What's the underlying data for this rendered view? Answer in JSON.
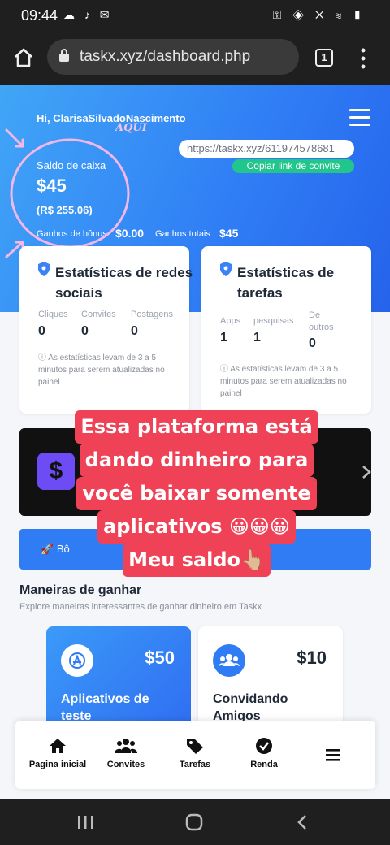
{
  "status_bar": {
    "time": "09:44"
  },
  "browser": {
    "url": "taskx.xyz/dashboard.php",
    "tab_count": "1"
  },
  "hero": {
    "greeting": "Hi, ClarisaSilvadoNascimento",
    "annotation": "AQUI",
    "invite_url": "https://taskx.xyz/611974578681",
    "copy_button": "Copiar link de convite",
    "saldo_label": "Saldo de caixa",
    "saldo_usd": "$45",
    "saldo_brl": "(R$ 255,06)",
    "bonus_label": "Ganhos de bônus",
    "bonus_value": "$0.00",
    "total_label": "Ganhos totais",
    "total_value": "$45"
  },
  "social_stats": {
    "title": "Estatísticas de redes sociais",
    "stats": [
      {
        "label": "Cliques",
        "value": "0"
      },
      {
        "label": "Convites",
        "value": "0"
      },
      {
        "label": "Postagens",
        "value": "0"
      }
    ],
    "note": "As estatísticas levam de 3 a 5 minutos para serem atualizadas no painel"
  },
  "task_stats": {
    "title": "Estatísticas de tarefas",
    "stats": [
      {
        "label": "Apps",
        "value": "1"
      },
      {
        "label": "pesquisas",
        "value": "1"
      },
      {
        "label": "De outros",
        "value": "0"
      }
    ],
    "note": "As estatísticas levam de 3 a 5 minutos para serem atualizadas no painel"
  },
  "banner": {
    "tile_symbol": "$"
  },
  "bonus_button": {
    "label": "Bô"
  },
  "ways": {
    "title": "Maneiras de ganhar",
    "subtitle": "Explore maneiras interessantes de ganhar dinheiro em Taskx",
    "cards": [
      {
        "amount": "$50",
        "name": "Aplicativos de teste",
        "color": "#3b82f6"
      },
      {
        "amount": "$10",
        "name": "Convidando Amigos",
        "color": "#ffffff"
      }
    ]
  },
  "bottom_nav": [
    {
      "label": "Pagina inicial",
      "icon": "home-icon"
    },
    {
      "label": "Convites",
      "icon": "users-icon"
    },
    {
      "label": "Tarefas",
      "icon": "tag-icon"
    },
    {
      "label": "Renda",
      "icon": "check-circle-icon"
    },
    {
      "label": "",
      "icon": "menu-icon"
    }
  ],
  "caption": {
    "lines": [
      "Essa plataforma está",
      "dando dinheiro para",
      "você baixar somente",
      "aplicativos 😀😀😀",
      "Meu saldo👆🏼"
    ]
  },
  "colors": {
    "accent": "#2f7cf5",
    "copy_button": "#22c58b",
    "caption_bg": "#ef4256"
  }
}
